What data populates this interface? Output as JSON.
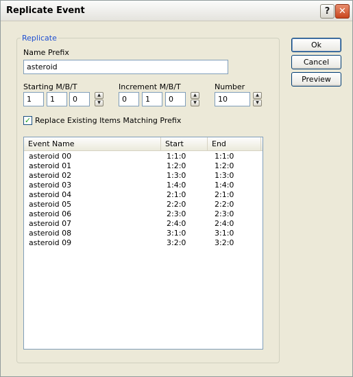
{
  "window": {
    "title": "Replicate Event",
    "help_label": "?",
    "close_label": "✕"
  },
  "group": {
    "legend": "Replicate",
    "name_prefix_label": "Name Prefix",
    "name_prefix_value": "asteroid",
    "starting_label": "Starting M/B/T",
    "starting_m": "1",
    "starting_b": "1",
    "starting_t": "0",
    "increment_label": "Increment M/B/T",
    "increment_m": "0",
    "increment_b": "1",
    "increment_t": "0",
    "number_label": "Number",
    "number_value": "10",
    "replace_checked": true,
    "replace_label": "Replace Existing Items Matching Prefix"
  },
  "list": {
    "columns": [
      "Event Name",
      "Start",
      "End"
    ],
    "rows": [
      {
        "name": "asteroid 00",
        "start": "1:1:0",
        "end": "1:1:0"
      },
      {
        "name": "asteroid 01",
        "start": "1:2:0",
        "end": "1:2:0"
      },
      {
        "name": "asteroid 02",
        "start": "1:3:0",
        "end": "1:3:0"
      },
      {
        "name": "asteroid 03",
        "start": "1:4:0",
        "end": "1:4:0"
      },
      {
        "name": "asteroid 04",
        "start": "2:1:0",
        "end": "2:1:0"
      },
      {
        "name": "asteroid 05",
        "start": "2:2:0",
        "end": "2:2:0"
      },
      {
        "name": "asteroid 06",
        "start": "2:3:0",
        "end": "2:3:0"
      },
      {
        "name": "asteroid 07",
        "start": "2:4:0",
        "end": "2:4:0"
      },
      {
        "name": "asteroid 08",
        "start": "3:1:0",
        "end": "3:1:0"
      },
      {
        "name": "asteroid 09",
        "start": "3:2:0",
        "end": "3:2:0"
      }
    ]
  },
  "buttons": {
    "ok": "Ok",
    "cancel": "Cancel",
    "preview": "Preview"
  },
  "icons": {
    "spin_up": "up-arrow-icon",
    "spin_down": "down-arrow-icon",
    "check": "check-icon"
  }
}
